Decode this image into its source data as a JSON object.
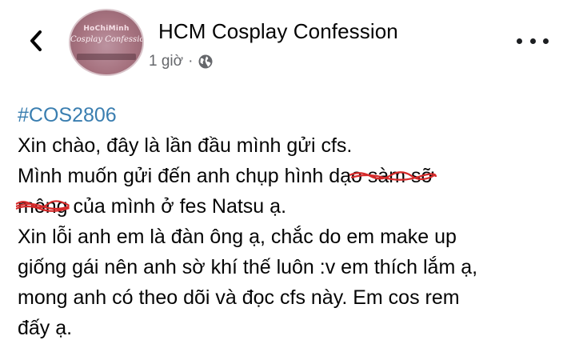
{
  "header": {
    "back_icon": "chevron-left-icon",
    "avatar": {
      "line1": "HoChiMinh",
      "line2": "Cosplay Confession"
    },
    "page_name": "HCM Cosplay Confession",
    "time": "1 giờ",
    "separator": "·",
    "privacy_icon": "globe-icon",
    "more_icon": "more-horizontal-icon"
  },
  "post": {
    "hashtag": "#COS2806",
    "lines": [
      "Xin chào, đây là lần đầu mình gửi cfs.",
      "Mình muốn gửi đến anh chụp hình dạ",
      "o sàm sỡ",
      " ",
      "mông",
      " của mình ở fes Natsu ạ.",
      "Xin lỗi anh em là đàn ông ạ, chắc do em make up",
      "giống gái nên anh sờ khí thế luôn :v em thích lắm ạ,",
      "mong anh có theo dõi và đọc cfs này. Em cos rem",
      "đấy ạ."
    ],
    "scribble_color": "#d62a2a",
    "hashtag_color": "#3a7eb0"
  }
}
